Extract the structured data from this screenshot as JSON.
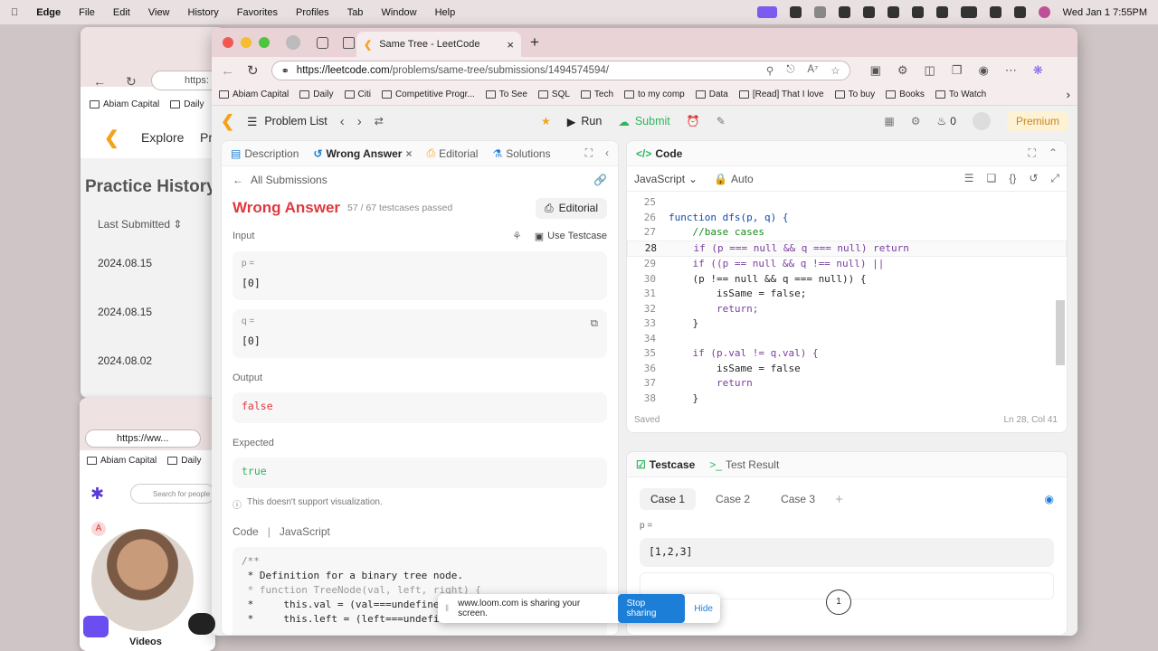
{
  "menubar": {
    "app": "Edge",
    "items": [
      "File",
      "Edit",
      "View",
      "History",
      "Favorites",
      "Profiles",
      "Tab",
      "Window",
      "Help"
    ],
    "clock": "Wed Jan 1  7:55PM"
  },
  "bg_window_1": {
    "url": "https:",
    "bookmarks": [
      "Abiam Capital",
      "Daily"
    ],
    "nav": [
      "Explore",
      "Pr"
    ],
    "title": "Practice History",
    "sort_label": "Last Submitted",
    "dates": [
      "2024.08.15",
      "2024.08.15",
      "2024.08.02"
    ]
  },
  "bg_window_2": {
    "url": "https://ww...",
    "bookmarks": [
      "Abiam Capital",
      "Daily"
    ],
    "search_placeholder": "Search for people",
    "avatar_letter": "A",
    "videos_label": "Videos"
  },
  "browser": {
    "tab_title": "Same Tree - LeetCode",
    "url_host": "https://leetcode.com",
    "url_path": "/problems/same-tree/submissions/1494574594/",
    "bookmarks": [
      "Abiam Capital",
      "Daily",
      "Citi",
      "Competitive Progr...",
      "To See",
      "SQL",
      "Tech",
      "to my comp",
      "Data",
      "[Read] That I love",
      "To buy",
      "Books",
      "To Watch"
    ]
  },
  "leetcode": {
    "problem_list": "Problem List",
    "run": "Run",
    "submit": "Submit",
    "streak": "0",
    "premium": "Premium",
    "left_tabs": [
      "Description",
      "Wrong Answer",
      "Editorial",
      "Solutions"
    ],
    "all_submissions": "All Submissions",
    "result_title": "Wrong Answer",
    "result_meta": "57 / 67  testcases passed",
    "editorial_btn": "Editorial",
    "input_label": "Input",
    "use_testcase": "Use Testcase",
    "p_key": "p =",
    "p_val": "[0]",
    "q_key": "q =",
    "q_val": "[0]",
    "output_label": "Output",
    "output_val": "false",
    "expected_label": "Expected",
    "expected_val": "true",
    "viz_note": "This doesn't support visualization.",
    "code_label": "Code",
    "code_lang": "JavaScript",
    "code_lines": [
      "/**",
      " * Definition for a binary tree node.",
      " * function TreeNode(val, left, right) {",
      " *     this.val = (val===undefine",
      " *     this.left = (left===undefi"
    ],
    "editor_title": "Code",
    "editor_lang": "JavaScript",
    "editor_mode": "Auto",
    "editor_lines": [
      {
        "n": "25",
        "t": ""
      },
      {
        "n": "26",
        "t": "function dfs(p, q) {"
      },
      {
        "n": "27",
        "t": "    //base cases"
      },
      {
        "n": "28",
        "t": "    if (p === null && q === null) return"
      },
      {
        "n": "29",
        "t": "    if ((p == null && q !== null) ||"
      },
      {
        "n": "30",
        "t": "    (p !== null && q === null)) {"
      },
      {
        "n": "31",
        "t": "        isSame = false;"
      },
      {
        "n": "32",
        "t": "        return;"
      },
      {
        "n": "33",
        "t": "    }"
      },
      {
        "n": "34",
        "t": ""
      },
      {
        "n": "35",
        "t": "    if (p.val != q.val) {"
      },
      {
        "n": "36",
        "t": "        isSame = false"
      },
      {
        "n": "37",
        "t": "        return"
      },
      {
        "n": "38",
        "t": "    }"
      }
    ],
    "saved": "Saved",
    "cursor_pos": "Ln 28, Col 41",
    "testcase_tab": "Testcase",
    "testresult_tab": "Test Result",
    "cases": [
      "Case 1",
      "Case 2",
      "Case 3"
    ],
    "tc_p_key": "p =",
    "tc_p_val": "[1,2,3]",
    "tree_node": "1"
  },
  "loom": {
    "message": "www.loom.com is sharing your screen.",
    "stop": "Stop sharing",
    "hide": "Hide"
  }
}
